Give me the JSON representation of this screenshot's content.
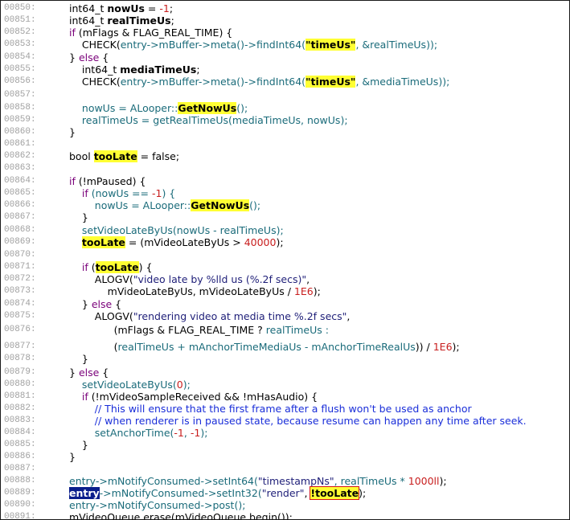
{
  "lines": [
    {
      "num": "00850:",
      "segs": [
        {
          "t": "int64_t ",
          "c": "plain"
        },
        {
          "t": "nowUs",
          "c": "bold"
        },
        {
          "t": " = ",
          "c": "plain"
        },
        {
          "t": "-1",
          "c": "num"
        },
        {
          "t": ";",
          "c": "plain"
        }
      ]
    },
    {
      "num": "00851:",
      "segs": [
        {
          "t": "int64_t ",
          "c": "plain"
        },
        {
          "t": "realTimeUs",
          "c": "bold"
        },
        {
          "t": ";",
          "c": "plain"
        }
      ]
    },
    {
      "num": "00852:",
      "segs": [
        {
          "t": "if ",
          "c": "kw"
        },
        {
          "t": "(mFlags & FLAG_REAL_TIME) {",
          "c": "plain"
        }
      ]
    },
    {
      "num": "00853:",
      "segs": [
        {
          "t": "    CHECK(",
          "c": "plain"
        },
        {
          "t": "entry->mBuffer->meta()->findInt64(",
          "c": "ptr"
        },
        {
          "t": "\"timeUs\"",
          "c": "hl"
        },
        {
          "t": ", &realTimeUs));",
          "c": "ptr"
        }
      ]
    },
    {
      "num": "00854:",
      "segs": [
        {
          "t": "} ",
          "c": "plain"
        },
        {
          "t": "else",
          "c": "kw"
        },
        {
          "t": " {",
          "c": "plain"
        }
      ]
    },
    {
      "num": "00855:",
      "segs": [
        {
          "t": "    int64_t ",
          "c": "plain"
        },
        {
          "t": "mediaTimeUs",
          "c": "bold"
        },
        {
          "t": ";",
          "c": "plain"
        }
      ]
    },
    {
      "num": "00856:",
      "segs": [
        {
          "t": "    CHECK(",
          "c": "plain"
        },
        {
          "t": "entry->mBuffer->meta()->findInt64(",
          "c": "ptr"
        },
        {
          "t": "\"timeUs\"",
          "c": "hl"
        },
        {
          "t": ", &mediaTimeUs));",
          "c": "ptr"
        }
      ]
    },
    {
      "num": "00857:",
      "segs": []
    },
    {
      "num": "00858:",
      "segs": [
        {
          "t": "    nowUs = ALooper::",
          "c": "var"
        },
        {
          "t": "GetNowUs",
          "c": "hl"
        },
        {
          "t": "();",
          "c": "var"
        }
      ]
    },
    {
      "num": "00859:",
      "segs": [
        {
          "t": "    realTimeUs = getRealTimeUs(mediaTimeUs, nowUs);",
          "c": "var"
        }
      ]
    },
    {
      "num": "00860:",
      "segs": [
        {
          "t": "}",
          "c": "plain"
        }
      ]
    },
    {
      "num": "00861:",
      "segs": []
    },
    {
      "num": "00862:",
      "segs": [
        {
          "t": "bool ",
          "c": "plain"
        },
        {
          "t": "tooLate",
          "c": "hl"
        },
        {
          "t": " = false;",
          "c": "plain"
        }
      ]
    },
    {
      "num": "00863:",
      "segs": []
    },
    {
      "num": "00864:",
      "segs": [
        {
          "t": "if ",
          "c": "kw"
        },
        {
          "t": "(!mPaused) {",
          "c": "plain"
        }
      ]
    },
    {
      "num": "00865:",
      "segs": [
        {
          "t": "    if ",
          "c": "kw"
        },
        {
          "t": "(nowUs == ",
          "c": "var"
        },
        {
          "t": "-1",
          "c": "num"
        },
        {
          "t": ") {",
          "c": "var"
        }
      ]
    },
    {
      "num": "00866:",
      "segs": [
        {
          "t": "        nowUs = ALooper::",
          "c": "var"
        },
        {
          "t": "GetNowUs",
          "c": "hl"
        },
        {
          "t": "();",
          "c": "var"
        }
      ]
    },
    {
      "num": "00867:",
      "segs": [
        {
          "t": "    }",
          "c": "plain"
        }
      ]
    },
    {
      "num": "00868:",
      "segs": [
        {
          "t": "    setVideoLateByUs(nowUs - realTimeUs);",
          "c": "var"
        }
      ]
    },
    {
      "num": "00869:",
      "segs": [
        {
          "t": "    ",
          "c": "plain"
        },
        {
          "t": "tooLate",
          "c": "hl"
        },
        {
          "t": " = (mVideoLateByUs > ",
          "c": "plain"
        },
        {
          "t": "40000",
          "c": "num"
        },
        {
          "t": ");",
          "c": "plain"
        }
      ]
    },
    {
      "num": "00870:",
      "segs": []
    },
    {
      "num": "00871:",
      "segs": [
        {
          "t": "    if ",
          "c": "kw"
        },
        {
          "t": "(",
          "c": "plain"
        },
        {
          "t": "tooLate",
          "c": "hl"
        },
        {
          "t": ") {",
          "c": "plain"
        }
      ]
    },
    {
      "num": "00872:",
      "segs": [
        {
          "t": "        ALOGV(",
          "c": "plain"
        },
        {
          "t": "\"video late by %lld us (%.2f secs)\"",
          "c": "str"
        },
        {
          "t": ",",
          "c": "plain"
        }
      ]
    },
    {
      "num": "00873:",
      "segs": [
        {
          "t": "            mVideoLateByUs, mVideoLateByUs / ",
          "c": "plain"
        },
        {
          "t": "1E6",
          "c": "num"
        },
        {
          "t": ");",
          "c": "plain"
        }
      ]
    },
    {
      "num": "00874:",
      "segs": [
        {
          "t": "    } ",
          "c": "plain"
        },
        {
          "t": "else",
          "c": "kw"
        },
        {
          "t": " {",
          "c": "plain"
        }
      ]
    },
    {
      "num": "00875:",
      "segs": [
        {
          "t": "        ALOGV(",
          "c": "plain"
        },
        {
          "t": "\"rendering video at media time %.2f secs\"",
          "c": "str"
        },
        {
          "t": ",",
          "c": "plain"
        }
      ]
    },
    {
      "num": "00876:",
      "segs": [
        {
          "t": "              (mFlags & FLAG_REAL_TIME ? ",
          "c": "plain"
        },
        {
          "t": "realTimeUs :",
          "c": "var"
        }
      ]
    },
    {
      "num": "00877:",
      "segs": [
        {
          "t": "              (",
          "c": "plain"
        },
        {
          "t": "realTimeUs + mAnchorTimeMediaUs - mAnchorTimeRealUs",
          "c": "var"
        },
        {
          "t": ")) / ",
          "c": "plain"
        },
        {
          "t": "1E6",
          "c": "num"
        },
        {
          "t": ");",
          "c": "plain"
        }
      ]
    },
    {
      "num": "00878:",
      "segs": [
        {
          "t": "    }",
          "c": "plain"
        }
      ]
    },
    {
      "num": "00879:",
      "segs": [
        {
          "t": "} ",
          "c": "plain"
        },
        {
          "t": "else",
          "c": "kw"
        },
        {
          "t": " {",
          "c": "plain"
        }
      ]
    },
    {
      "num": "00880:",
      "segs": [
        {
          "t": "    setVideoLateByUs(",
          "c": "var"
        },
        {
          "t": "0",
          "c": "num"
        },
        {
          "t": ");",
          "c": "var"
        }
      ]
    },
    {
      "num": "00881:",
      "segs": [
        {
          "t": "    if ",
          "c": "kw"
        },
        {
          "t": "(!mVideoSampleReceived && !mHasAudio) {",
          "c": "plain"
        }
      ]
    },
    {
      "num": "00882:",
      "segs": [
        {
          "t": "        // This will ensure that the first frame after a flush won't be used as anchor",
          "c": "comment"
        }
      ]
    },
    {
      "num": "00883:",
      "segs": [
        {
          "t": "        // when renderer is in paused state, because resume can happen any time after seek.",
          "c": "comment"
        }
      ]
    },
    {
      "num": "00884:",
      "segs": [
        {
          "t": "        setAnchorTime(",
          "c": "var"
        },
        {
          "t": "-1",
          "c": "num"
        },
        {
          "t": ", ",
          "c": "var"
        },
        {
          "t": "-1",
          "c": "num"
        },
        {
          "t": ");",
          "c": "var"
        }
      ]
    },
    {
      "num": "00885:",
      "segs": [
        {
          "t": "    }",
          "c": "plain"
        }
      ]
    },
    {
      "num": "00886:",
      "segs": [
        {
          "t": "}",
          "c": "plain"
        }
      ]
    },
    {
      "num": "00887:",
      "segs": []
    },
    {
      "num": "00888:",
      "segs": [
        {
          "t": "entry->mNotifyConsumed->setInt64(",
          "c": "ptr"
        },
        {
          "t": "\"timestampNs\"",
          "c": "str"
        },
        {
          "t": ", realTimeUs * ",
          "c": "var"
        },
        {
          "t": "1000ll",
          "c": "num"
        },
        {
          "t": ");",
          "c": "plain"
        }
      ]
    },
    {
      "num": "00889:",
      "segs": [
        {
          "t": "entry",
          "c": "sel"
        },
        {
          "t": "->mNotifyConsumed->setInt32(",
          "c": "ptr"
        },
        {
          "t": "\"render\"",
          "c": "str"
        },
        {
          "t": ", ",
          "c": "plain"
        },
        {
          "t": "!tooLate",
          "c": "box"
        },
        {
          "t": ");",
          "c": "plain"
        }
      ]
    },
    {
      "num": "00890:",
      "segs": [
        {
          "t": "entry->mNotifyConsumed->post();",
          "c": "ptr"
        }
      ]
    },
    {
      "num": "00891:",
      "segs": [
        {
          "t": "mVideoQueue.erase(mVideoQueue.begin());",
          "c": "plain"
        }
      ]
    }
  ]
}
